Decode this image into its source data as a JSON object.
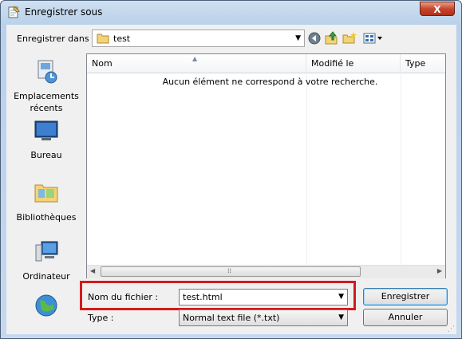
{
  "window": {
    "title": "Enregistrer sous",
    "close_label": "X"
  },
  "toolbar": {
    "save_in_label": "Enregistrer dans :",
    "current_folder": "test",
    "icons": [
      "back-icon",
      "up-folder-icon",
      "new-folder-icon",
      "views-icon"
    ]
  },
  "places": [
    {
      "label": "Emplacements récents",
      "icon": "recent-places-icon"
    },
    {
      "label": "Bureau",
      "icon": "desktop-icon"
    },
    {
      "label": "Bibliothèques",
      "icon": "libraries-icon"
    },
    {
      "label": "Ordinateur",
      "icon": "computer-icon"
    },
    {
      "label": "",
      "icon": "network-icon"
    }
  ],
  "file_list": {
    "columns": [
      "Nom",
      "Modifié le",
      "Type"
    ],
    "empty_message": "Aucun élément ne correspond à votre recherche."
  },
  "form": {
    "filename_label": "Nom du fichier :",
    "filename_value": "test.html",
    "type_label": "Type :",
    "type_value": "Normal text file (*.txt)"
  },
  "buttons": {
    "save": "Enregistrer",
    "cancel": "Annuler"
  },
  "colors": {
    "highlight": "#d21b1b",
    "accent": "#3c7fb1"
  }
}
